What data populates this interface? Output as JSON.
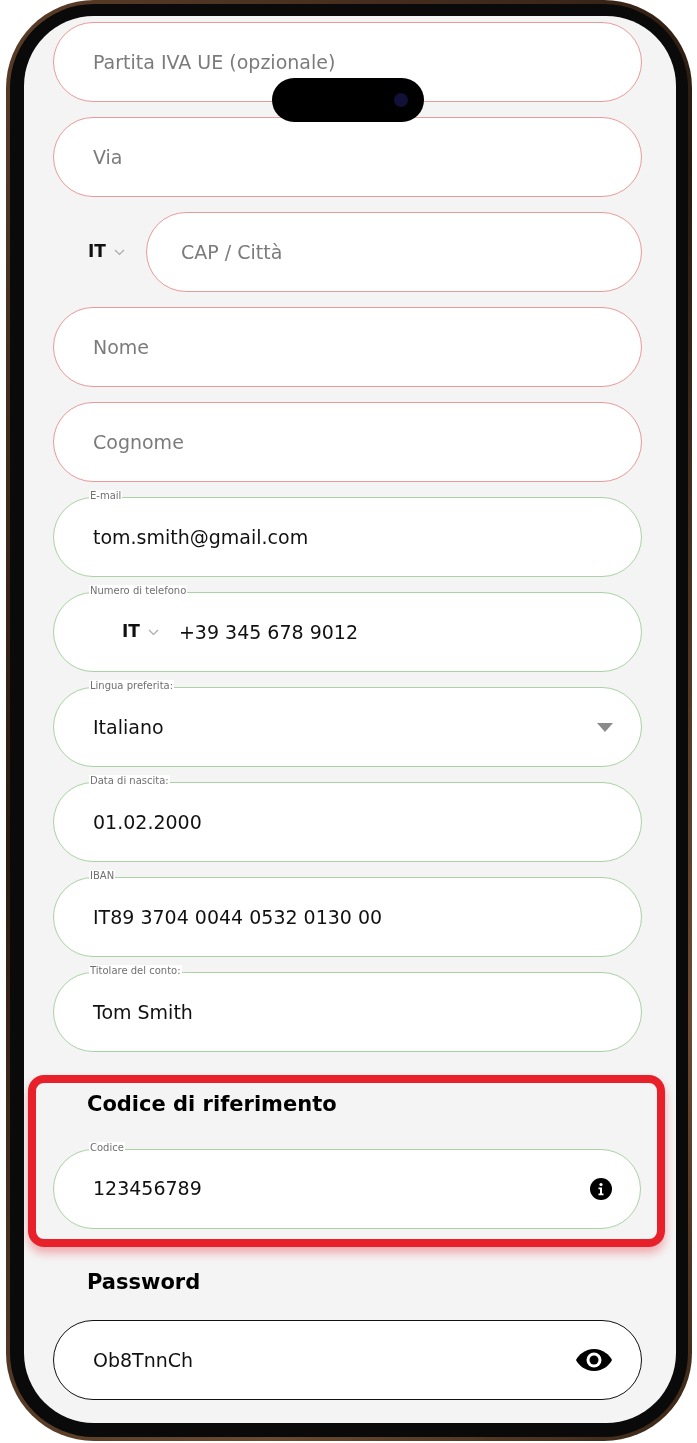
{
  "fields": [
    {
      "kind": "text",
      "placeholder": "Partita IVA UE (opzionale)",
      "valid": false
    },
    {
      "kind": "text",
      "placeholder": "Via",
      "valid": false
    },
    {
      "kind": "city",
      "country": "IT",
      "placeholder": "CAP / Città",
      "valid": false
    },
    {
      "kind": "text",
      "placeholder": "Nome",
      "valid": false
    },
    {
      "kind": "text",
      "placeholder": "Cognome",
      "valid": false
    },
    {
      "kind": "text",
      "label": "E-mail",
      "value": "tom.smith@gmail.com",
      "valid": true
    },
    {
      "kind": "phone",
      "label": "Numero di telefono",
      "country": "IT",
      "value": "+39 345 678 9012",
      "valid": true
    },
    {
      "kind": "select",
      "label": "Lingua preferita:",
      "value": "Italiano",
      "valid": true
    },
    {
      "kind": "text",
      "label": "Data di nascita:",
      "value": "01.02.2000",
      "valid": true
    },
    {
      "kind": "text",
      "label": "IBAN",
      "value": "IT89 3704 0044 0532 0130 00",
      "valid": true
    },
    {
      "kind": "text",
      "label": "Titolare del conto:",
      "value": "Tom Smith",
      "valid": true
    }
  ],
  "referral": {
    "title": "Codice di riferimento",
    "highlighted": true,
    "field": {
      "kind": "info",
      "label": "Codice",
      "value": "123456789",
      "valid": true
    }
  },
  "password": {
    "title": "Password",
    "value": "Ob8TnnCh"
  }
}
